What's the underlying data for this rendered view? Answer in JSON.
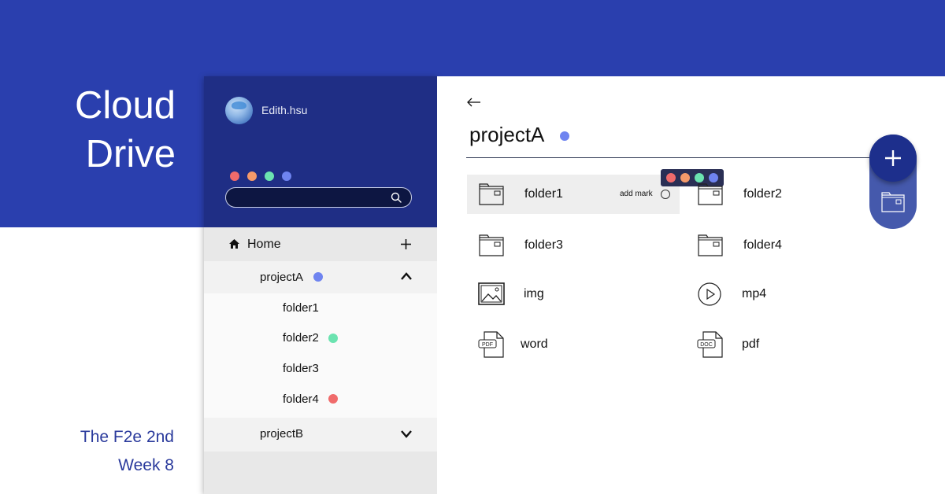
{
  "brand": {
    "title_line1": "Cloud",
    "title_line2": "Drive",
    "subtitle_line1": "The F2e 2nd",
    "subtitle_line2": "Week 8"
  },
  "sidebar": {
    "username": "Edith.hsu",
    "color_dots": [
      "#f06b6b",
      "#f49a6a",
      "#6be3b0",
      "#6f84f0"
    ],
    "search": {
      "placeholder": "",
      "value": ""
    },
    "home_label": "Home",
    "projects": [
      {
        "label": "projectA",
        "mark_color": "#6f84f0",
        "expanded": true,
        "folders": [
          {
            "label": "folder1",
            "mark_color": ""
          },
          {
            "label": "folder2",
            "mark_color": "#6be3b0"
          },
          {
            "label": "folder3",
            "mark_color": ""
          },
          {
            "label": "folder4",
            "mark_color": "#f06b6b"
          }
        ]
      },
      {
        "label": "projectB",
        "mark_color": "",
        "expanded": false
      }
    ]
  },
  "main": {
    "title": "projectA",
    "title_mark_color": "#6f84f0",
    "add_mark_label": "add mark",
    "picker_colors": [
      "#f06b6b",
      "#f49a6a",
      "#6be3b0",
      "#6f84f0"
    ],
    "files": [
      {
        "name": "folder1",
        "icon": "folder-icon",
        "selected": true
      },
      {
        "name": "folder2",
        "icon": "folder-icon"
      },
      {
        "name": "folder3",
        "icon": "folder-icon"
      },
      {
        "name": "folder4",
        "icon": "folder-icon"
      },
      {
        "name": "img",
        "icon": "image-icon"
      },
      {
        "name": "mp4",
        "icon": "play-icon"
      },
      {
        "name": "word",
        "icon": "pdf-file-icon",
        "icon_text": "PDF"
      },
      {
        "name": "pdf",
        "icon": "doc-file-icon",
        "icon_text": "DOC"
      }
    ]
  },
  "colors": {
    "brand_blue": "#2a3fae",
    "sidebar_header": "#1f2e85",
    "fab": "#1d2f8c",
    "fab_group": "#4559ac"
  }
}
